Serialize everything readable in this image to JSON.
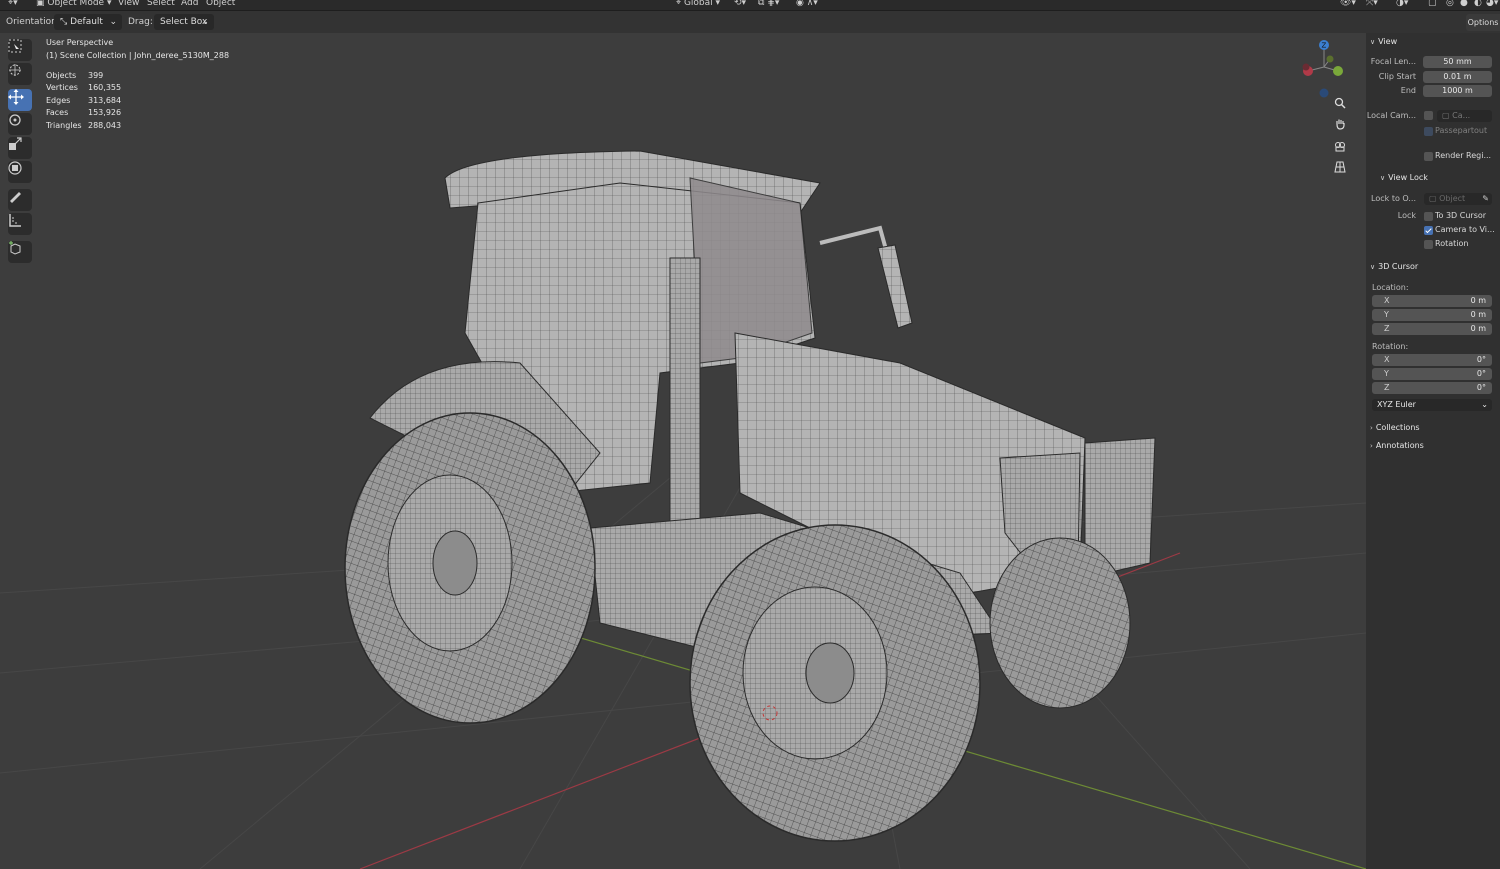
{
  "header": {
    "mode_label": "Object Mode",
    "menu": [
      "View",
      "Select",
      "Add",
      "Object"
    ],
    "transform_label": "Global"
  },
  "tool_settings": {
    "orientation_label": "Orientation:",
    "orientation_value": "Default",
    "drag_label": "Drag:",
    "drag_value": "Select Box",
    "options_label": "Options"
  },
  "viewport": {
    "perspective": "User Perspective",
    "collection": "(1) Scene Collection | John_deree_5130M_288",
    "stats": [
      {
        "label": "Objects",
        "value": "399"
      },
      {
        "label": "Vertices",
        "value": "160,355"
      },
      {
        "label": "Edges",
        "value": "313,684"
      },
      {
        "label": "Faces",
        "value": "153,926"
      },
      {
        "label": "Triangles",
        "value": "288,043"
      }
    ],
    "gizmo_axis": "Z"
  },
  "toolbar": {
    "tools": [
      "select-box-tool",
      "cursor-tool",
      "move-tool",
      "rotate-tool",
      "scale-tool",
      "transform-tool",
      "annotate-tool",
      "measure-tool",
      "add-cube-tool"
    ],
    "active": "move-tool"
  },
  "sidebar": {
    "view": {
      "title": "View",
      "focal_length_label": "Focal Len...",
      "focal_length": "50 mm",
      "clip_start_label": "Clip Start",
      "clip_start": "0.01 m",
      "end_label": "End",
      "end": "1000 m",
      "local_camera_label": "Local Cam...",
      "local_camera_value": "Ca...",
      "passepartout_label": "Passepartout",
      "render_region_label": "Render Regi..."
    },
    "view_lock": {
      "title": "View Lock",
      "lock_to_object_label": "Lock to O...",
      "lock_to_object_placeholder": "Object",
      "lock_label": "Lock",
      "to_3d_cursor_label": "To 3D Cursor",
      "camera_to_view_label": "Camera to Vi...",
      "camera_to_view_checked": true,
      "rotation_label": "Rotation"
    },
    "cursor": {
      "title": "3D Cursor",
      "location_label": "Location:",
      "location": [
        {
          "axis": "X",
          "value": "0 m"
        },
        {
          "axis": "Y",
          "value": "0 m"
        },
        {
          "axis": "Z",
          "value": "0 m"
        }
      ],
      "rotation_label": "Rotation:",
      "rotation": [
        {
          "axis": "X",
          "value": "0°"
        },
        {
          "axis": "Y",
          "value": "0°"
        },
        {
          "axis": "Z",
          "value": "0°"
        }
      ],
      "rotation_mode": "XYZ Euler"
    },
    "collections_title": "Collections",
    "annotations_title": "Annotations"
  },
  "colors": {
    "accent": "#4772b3",
    "viewport_bg": "#3d3d3d",
    "x_axis": "#b03a48",
    "y_axis": "#7aa83a",
    "z_axis": "#3b7fd1"
  }
}
